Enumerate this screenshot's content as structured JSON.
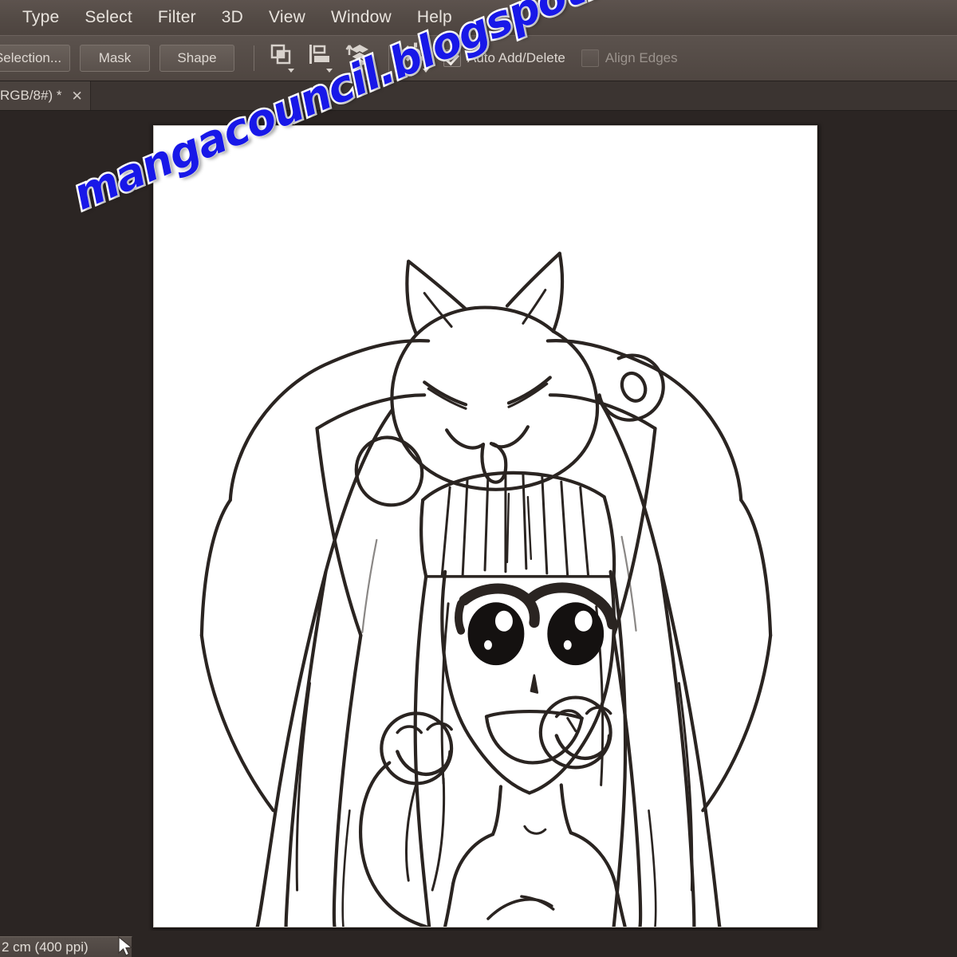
{
  "app": {
    "name": "Adobe Photoshop",
    "theme_bg": "#2b2523",
    "chrome_bg": "#554c47",
    "accent": "#1818e8"
  },
  "menubar": {
    "items": [
      {
        "label": "",
        "name": "menu-item-clipped",
        "clipped": true
      },
      {
        "label": "Type",
        "name": "menu-item-type"
      },
      {
        "label": "Select",
        "name": "menu-item-select"
      },
      {
        "label": "Filter",
        "name": "menu-item-filter"
      },
      {
        "label": "3D",
        "name": "menu-item-3d"
      },
      {
        "label": "View",
        "name": "menu-item-view"
      },
      {
        "label": "Window",
        "name": "menu-item-window"
      },
      {
        "label": "Help",
        "name": "menu-item-help"
      }
    ]
  },
  "optionsbar": {
    "selection_button": "Selection...",
    "mask_button": "Mask",
    "shape_button": "Shape",
    "path_operations_icon": "path-operations-icon",
    "path_alignment_icon": "path-alignment-icon",
    "path_arrangement_icon": "path-arrangement-icon",
    "gear_icon": "gear-icon",
    "auto_add_delete": {
      "label": "Auto Add/Delete",
      "checked": true
    },
    "align_edges": {
      "label": "Align Edges",
      "checked": false
    }
  },
  "tabbar": {
    "active_tab": {
      "label": "RGB/8#) *",
      "close_glyph": "✕",
      "modified": true
    }
  },
  "document": {
    "canvas_background": "#ffffff",
    "artwork_title": "Anime girl with cat mascot on head — line art",
    "artwork_elements": [
      "cat-mascot-head",
      "girl-face",
      "long-hair",
      "bangs",
      "raised-arms",
      "smiley-hair-ornament-left",
      "smiley-hair-ornament-right",
      "torso"
    ]
  },
  "statusbar": {
    "text": "2 cm (400 ppi)",
    "cursor_icon": "mouse-pointer-icon"
  },
  "watermark": {
    "text": "mangacouncil.blogspot.com",
    "color": "#1818e8",
    "outline_color": "#ffffff",
    "rotation_deg": -22.5
  }
}
